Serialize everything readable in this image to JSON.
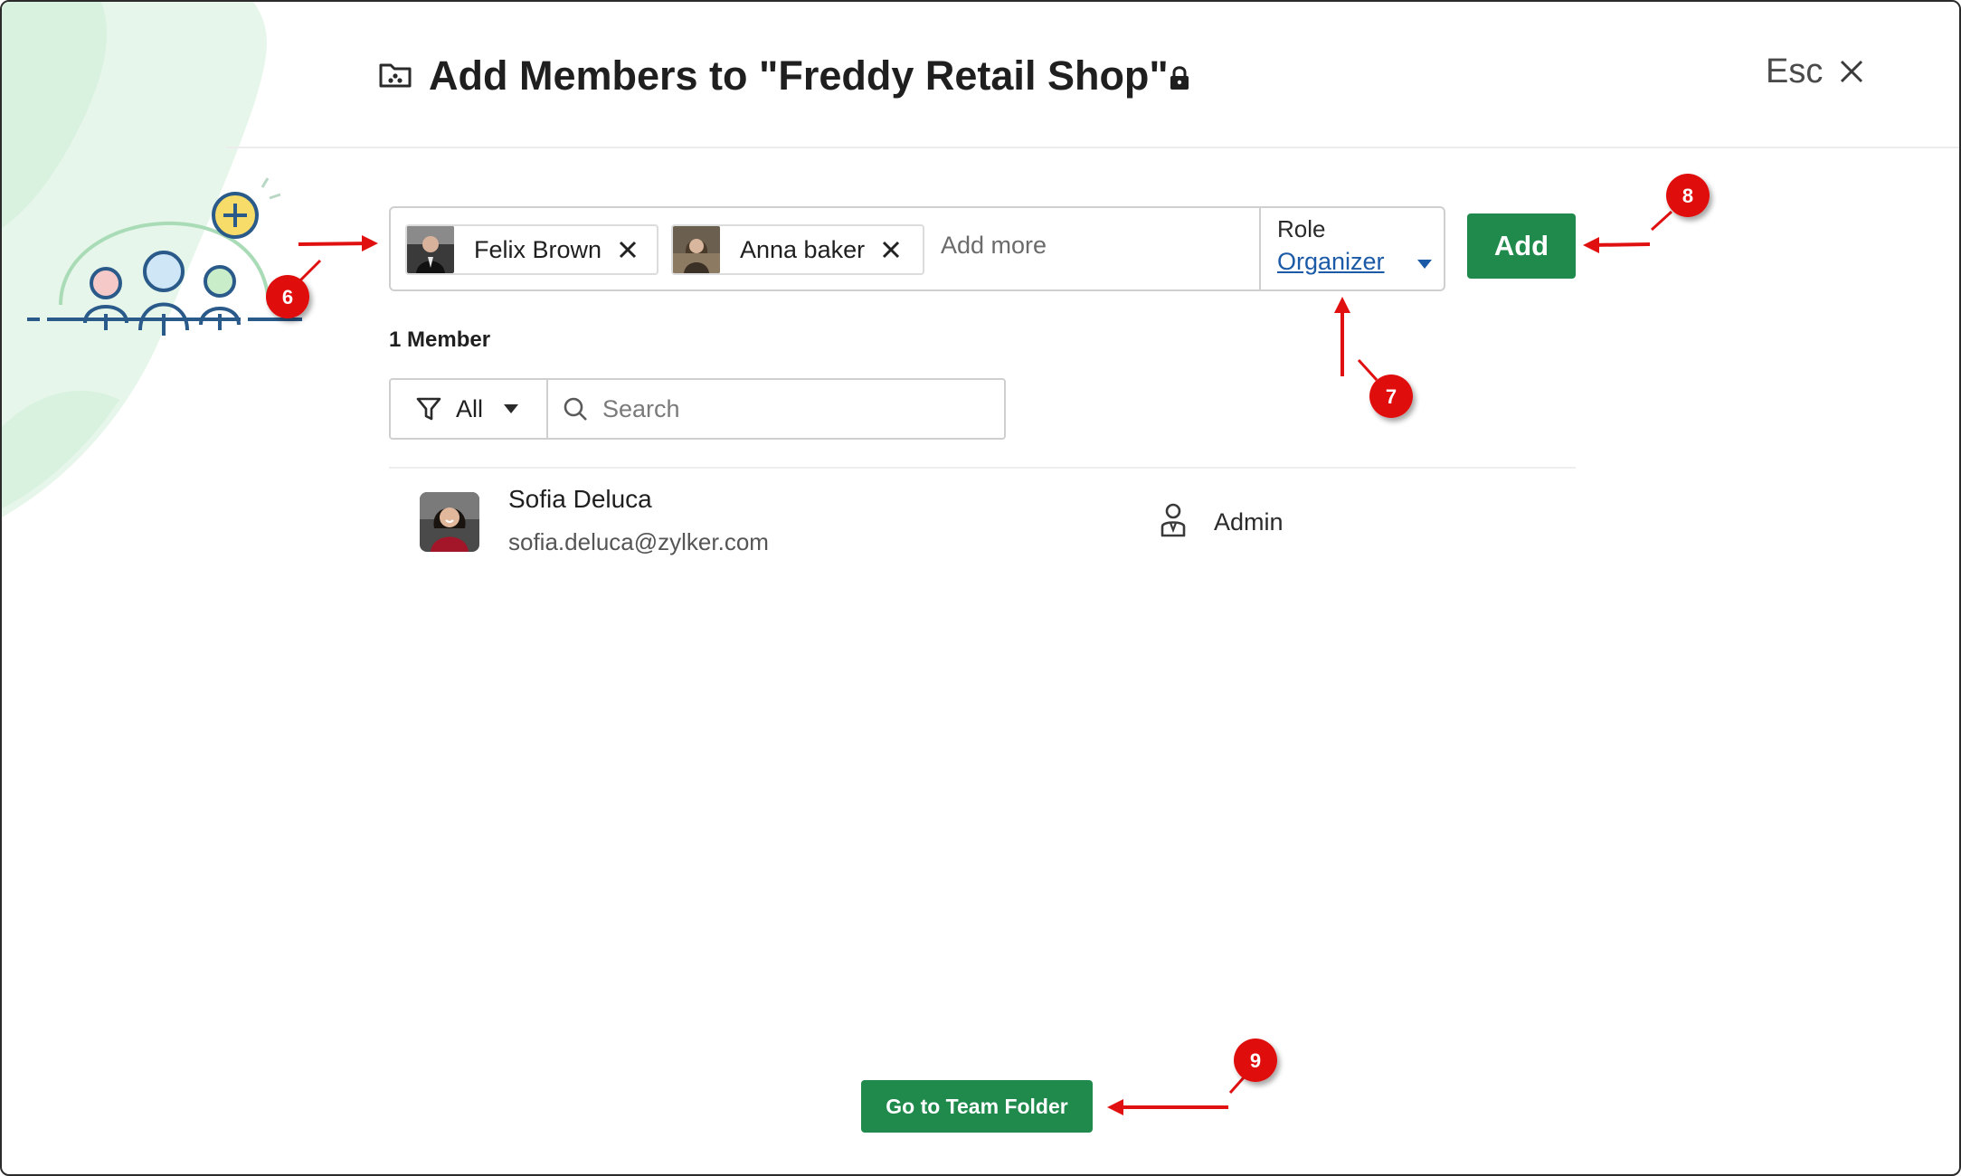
{
  "dialog": {
    "title": "Add Members to \"Freddy Retail Shop\"",
    "esc_label": "Esc"
  },
  "invite": {
    "chips": [
      {
        "name": "Felix Brown"
      },
      {
        "name": "Anna baker"
      }
    ],
    "add_more_placeholder": "Add more",
    "role_label": "Role",
    "role_value": "Organizer",
    "add_button": "Add"
  },
  "members": {
    "count_label": "1 Member",
    "filter_label": "All",
    "search_placeholder": "Search",
    "list": [
      {
        "name": "Sofia Deluca",
        "email": "sofia.deluca@zylker.com",
        "role": "Admin"
      }
    ]
  },
  "footer": {
    "go_button": "Go to Team Folder"
  },
  "annotations": {
    "badges": [
      "6",
      "7",
      "8",
      "9"
    ]
  },
  "colors": {
    "accent_green": "#1f8a4c",
    "link_blue": "#1a5aa6",
    "annotation_red": "#e01010"
  }
}
